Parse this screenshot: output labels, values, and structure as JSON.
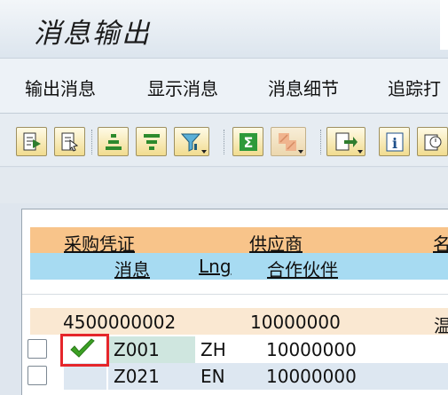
{
  "window": {
    "title": "消息输出"
  },
  "menu": {
    "items": [
      {
        "label": "输出消息"
      },
      {
        "label": "显示消息"
      },
      {
        "label": "消息细节"
      },
      {
        "label": "追踪打"
      }
    ]
  },
  "toolbar": {
    "buttons": [
      {
        "icon": "choose-detail-icon"
      },
      {
        "icon": "select-detail-icon"
      },
      {
        "icon": "sort-ascending-icon"
      },
      {
        "icon": "sort-descending-icon"
      },
      {
        "icon": "filter-icon"
      },
      {
        "icon": "sum-icon"
      },
      {
        "icon": "subtotal-icon"
      },
      {
        "icon": "export-icon"
      },
      {
        "icon": "info-icon"
      },
      {
        "icon": "layout-icon"
      }
    ]
  },
  "colors": {
    "header_orange": "#f8c48a",
    "header_blue": "#a7dbf2",
    "row_main": "#fae8d2",
    "row_zebra": "#dde7f1",
    "status_ok": "#3ca024",
    "highlight": "#e5262b"
  },
  "grid": {
    "header1": {
      "col1": "采购凭证",
      "col2": "供应商",
      "col3": "名"
    },
    "header2": {
      "col1": "消息",
      "col2": "Lng",
      "col3": "合作伙伴"
    },
    "main_row": {
      "doc": "4500000002",
      "vendor": "10000000",
      "name": "温"
    },
    "messages": [
      {
        "status": "ok",
        "type": "Z001",
        "lang": "ZH",
        "partner": "10000000"
      },
      {
        "status": "",
        "type": "Z021",
        "lang": "EN",
        "partner": "10000000"
      }
    ]
  }
}
